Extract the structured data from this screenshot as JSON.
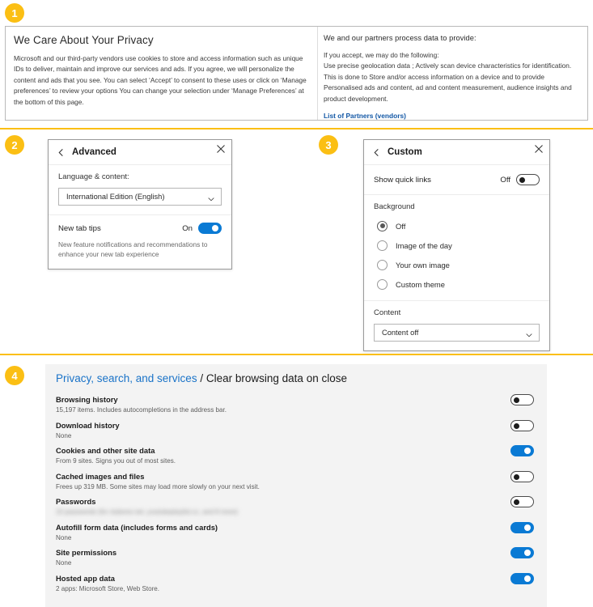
{
  "badges": {
    "one": "1",
    "two": "2",
    "three": "3",
    "four": "4"
  },
  "colors": {
    "badge_yellow": "#fbbf14",
    "toggle_on_blue": "#0a7ad4",
    "link_blue": "#1257a5",
    "breadcrumb_blue": "#1a73c8",
    "panel_bg": "#f3f3f3"
  },
  "consent": {
    "heading": "We Care About Your Privacy",
    "body": "Microsoft and our third-party vendors use cookies to store and access information such as unique IDs to deliver, maintain and improve our services and ads. If you agree, we will personalize the content and ads that you see. You can select ‘Accept’ to consent to these uses or click on ‘Manage preferences’ to review your options  You can change your selection under ‘Manage Preferences’ at the bottom of this page.",
    "right_heading": "We and our partners process data to provide:",
    "right_body": "If you accept, we may do the following:\nUse precise geolocation data ; Actively scan device characteristics for identification. This is done to Store and/or access information on a device and to provide Personalised ads and content, ad and content measurement, audience insights and product development.",
    "partners_link": "List of Partners (vendors)"
  },
  "advanced_panel": {
    "title": "Advanced",
    "back_icon": "chevron-left-icon",
    "close_icon": "close-icon",
    "language_label": "Language & content:",
    "language_value": "International Edition (English)",
    "dropdown_icon": "chevron-down-icon",
    "new_tab_tips_label": "New tab tips",
    "new_tab_tips_state": "On",
    "new_tab_tips_on": true,
    "new_tab_tips_desc": "New feature notifications and recommendations to enhance your new tab experience"
  },
  "custom_panel": {
    "title": "Custom",
    "back_icon": "chevron-left-icon",
    "close_icon": "close-icon",
    "quick_links_label": "Show quick links",
    "quick_links_state": "Off",
    "quick_links_on": false,
    "background_label": "Background",
    "background_options": [
      {
        "label": "Off",
        "selected": true
      },
      {
        "label": "Image of the day",
        "selected": false
      },
      {
        "label": "Your own image",
        "selected": false
      },
      {
        "label": "Custom theme",
        "selected": false
      }
    ],
    "content_label": "Content",
    "content_value": "Content off",
    "dropdown_icon": "chevron-down-icon"
  },
  "privacy_panel": {
    "breadcrumb": "Privacy, search, and services",
    "breadcrumb_separator": "/",
    "current_page": "Clear browsing data on close",
    "settings": [
      {
        "title": "Browsing history",
        "subtitle": "15,197 items. Includes autocompletions in the address bar.",
        "on": false,
        "blurred": false
      },
      {
        "title": "Download history",
        "subtitle": "None",
        "on": false,
        "blurred": false
      },
      {
        "title": "Cookies and other site data",
        "subtitle": "From 9 sites. Signs you out of most sites.",
        "on": true,
        "blurred": false
      },
      {
        "title": "Cached images and files",
        "subtitle": "Frees up 319 MB. Some sites may load more slowly on your next visit.",
        "on": false,
        "blurred": false
      },
      {
        "title": "Passwords",
        "subtitle": "10 passwords (for clubone.net, youtubeplaylist.cc, and 8 more)",
        "on": false,
        "blurred": true
      },
      {
        "title": "Autofill form data (includes forms and cards)",
        "subtitle": "None",
        "on": true,
        "blurred": false
      },
      {
        "title": "Site permissions",
        "subtitle": "None",
        "on": true,
        "blurred": false
      },
      {
        "title": "Hosted app data",
        "subtitle": "2 apps: Microsoft Store, Web Store.",
        "on": true,
        "blurred": false
      }
    ]
  }
}
